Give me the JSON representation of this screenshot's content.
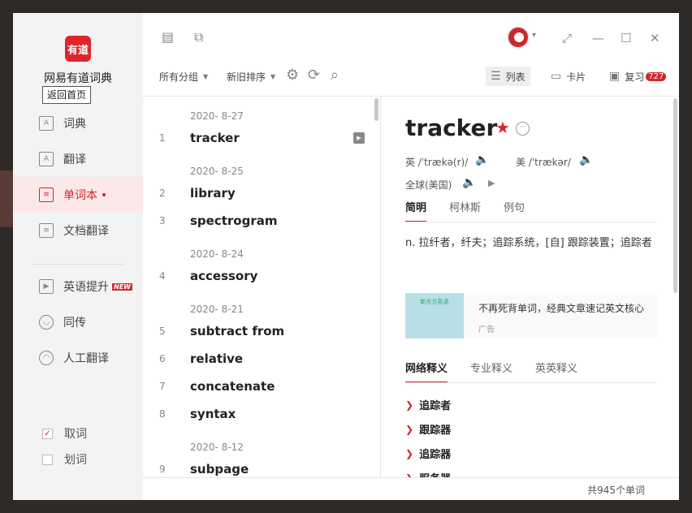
{
  "app": {
    "title": "网易有道词典",
    "logo_text": "有道",
    "home_button": "返回首页"
  },
  "sidebar": {
    "items": [
      {
        "label": "词典",
        "icon": "dict-icon"
      },
      {
        "label": "翻译",
        "icon": "translate-icon"
      },
      {
        "label": "单词本",
        "icon": "wordbook-icon",
        "active": true
      },
      {
        "label": "文档翻译",
        "icon": "doc-icon"
      },
      {
        "label": "英语提升",
        "icon": "video-icon",
        "badge": "NEW"
      },
      {
        "label": "同传",
        "icon": "simultaneous-icon"
      },
      {
        "label": "人工翻译",
        "icon": "human-translate-icon"
      }
    ],
    "options": [
      {
        "label": "取词",
        "checked": true
      },
      {
        "label": "划词",
        "checked": false
      }
    ]
  },
  "toolbar": {
    "group_filter": "所有分组",
    "sort_filter": "新旧排序",
    "view_list": "列表",
    "view_card": "卡片",
    "review": "复习",
    "review_count": "727"
  },
  "wordlist": {
    "groups": [
      {
        "date": "2020- 8-27",
        "words": [
          {
            "num": "1",
            "word": "tracker"
          }
        ]
      },
      {
        "date": "2020- 8-25",
        "words": [
          {
            "num": "2",
            "word": "library"
          },
          {
            "num": "3",
            "word": "spectrogram"
          }
        ]
      },
      {
        "date": "2020- 8-24",
        "words": [
          {
            "num": "4",
            "word": "accessory"
          }
        ]
      },
      {
        "date": "2020- 8-21",
        "words": [
          {
            "num": "5",
            "word": "subtract from"
          },
          {
            "num": "6",
            "word": "relative"
          },
          {
            "num": "7",
            "word": "concatenate"
          },
          {
            "num": "8",
            "word": "syntax"
          }
        ]
      },
      {
        "date": "2020- 8-12",
        "words": [
          {
            "num": "9",
            "word": "subpage"
          }
        ]
      }
    ]
  },
  "detail": {
    "word": "tracker",
    "uk_label": "英 /ˈtrækə(r)/",
    "us_label": "美 /ˈtrækər/",
    "global_label": "全球(美国)",
    "tabs": [
      "简明",
      "柯林斯",
      "例句"
    ],
    "definition": "n. 拉纤者，纤夫；追踪系统，[自] 跟踪装置；追踪者",
    "ad_text": "不再死背单词，经典文章速记英文核心",
    "ad_label": "广告",
    "ad_image_text": "新东方英语",
    "sub_tabs": [
      "网络释义",
      "专业释义",
      "英英释义"
    ],
    "net_defs": [
      "追踪者",
      "跟踪器",
      "追踪器",
      "服务器"
    ]
  },
  "status": {
    "total": "共945个单词"
  },
  "colors": {
    "accent": "#d8232a",
    "sidebar_bg": "#f3f3f3",
    "active_bg": "#fbe9e9"
  }
}
